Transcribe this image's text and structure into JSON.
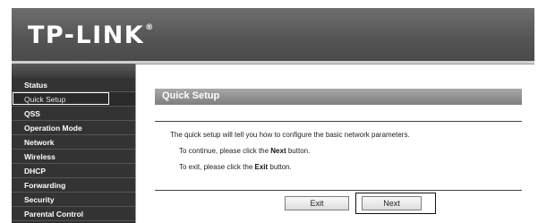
{
  "header": {
    "logo": "TP-LINK",
    "logo_mark": "®"
  },
  "sidebar": {
    "items": [
      {
        "label": "Status"
      },
      {
        "label": "Quick Setup"
      },
      {
        "label": "QSS"
      },
      {
        "label": "Operation Mode"
      },
      {
        "label": "Network"
      },
      {
        "label": "Wireless"
      },
      {
        "label": "DHCP"
      },
      {
        "label": "Forwarding"
      },
      {
        "label": "Security"
      },
      {
        "label": "Parental Control"
      }
    ],
    "active_index": 1
  },
  "main": {
    "title": "Quick Setup",
    "intro": "The quick setup will tell you how to configure the basic network parameters.",
    "continue_prefix": "To continue, please click the ",
    "continue_bold": "Next",
    "continue_suffix": " button.",
    "exit_prefix": "To exit, please click the ",
    "exit_bold": "Exit",
    "exit_suffix": " button.",
    "buttons": {
      "exit": "Exit",
      "next": "Next"
    }
  }
}
